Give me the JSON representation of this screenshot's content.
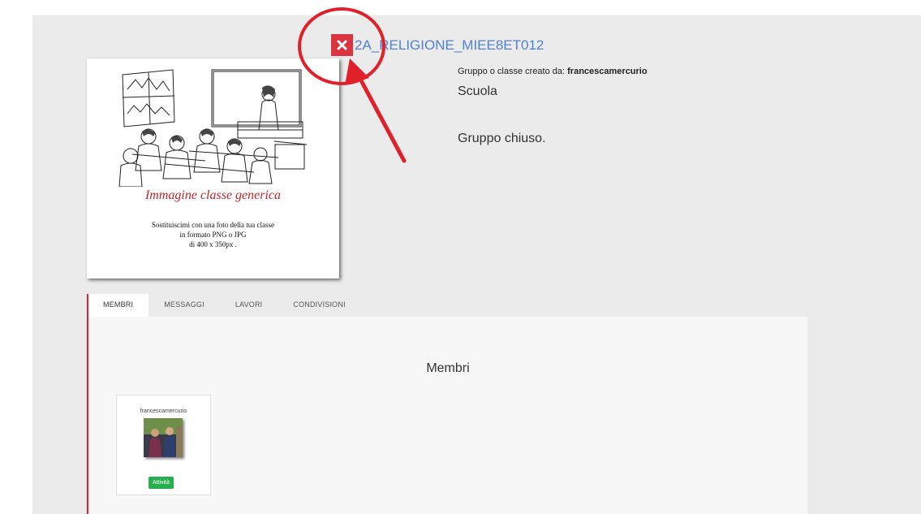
{
  "group": {
    "title": "2A_RELIGIONE_MIEE8ET012",
    "created_by_label": "Gruppo o classe creato da:",
    "created_by_user": "francescamercurio",
    "school": "Scuola",
    "status": "Gruppo chiuso."
  },
  "class_image": {
    "caption": "Immagine classe generica",
    "subtext_lines": [
      "Sostituiscimi con una foto della tua classe",
      "in formato PNG o JPG",
      "di 400 x 350px ."
    ]
  },
  "tabs": [
    {
      "label": "MEMBRI",
      "active": true
    },
    {
      "label": "MESSAGGI",
      "active": false
    },
    {
      "label": "LAVORI",
      "active": false
    },
    {
      "label": "CONDIVISIONI",
      "active": false
    }
  ],
  "members_section": {
    "heading": "Membri",
    "members": [
      {
        "name": "francescamercurio",
        "button_label": "Attività"
      }
    ]
  },
  "icons": {
    "delete": "close-icon"
  },
  "colors": {
    "accent_red": "#d9343f",
    "link_blue": "#4f82d6",
    "active_green": "#27ae4f",
    "annotation_red": "#e0202a"
  }
}
